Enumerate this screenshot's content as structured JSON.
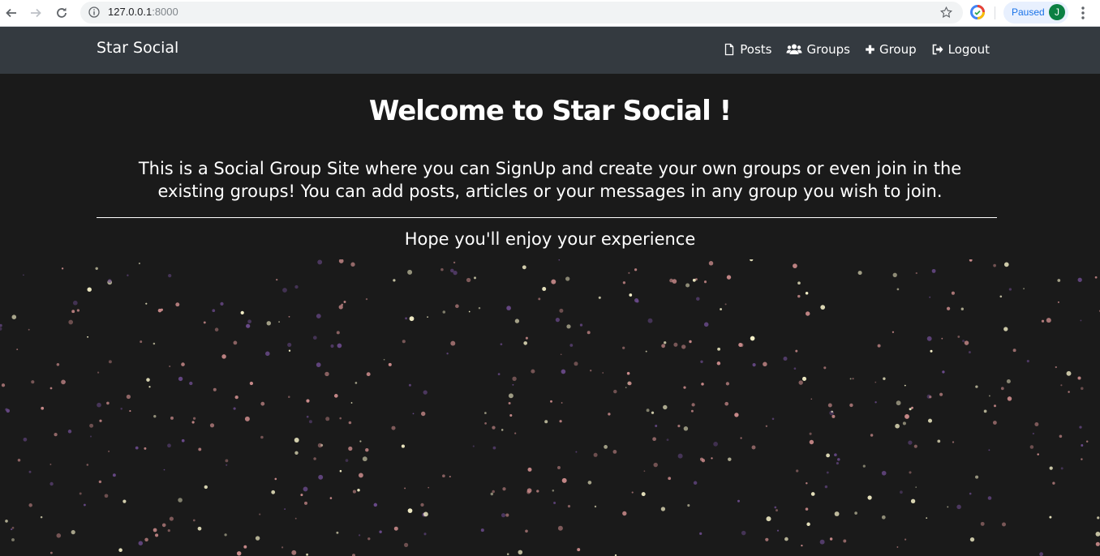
{
  "browser": {
    "url_host": "127.0.0.1",
    "url_port": ":8000",
    "profile_status": "Paused",
    "profile_initial": "J"
  },
  "navbar": {
    "brand": "Star Social",
    "links": [
      {
        "label": "Posts",
        "icon": "file-icon"
      },
      {
        "label": "Groups",
        "icon": "users-icon"
      },
      {
        "label": "Group",
        "icon": "plus-icon"
      },
      {
        "label": "Logout",
        "icon": "logout-icon"
      }
    ]
  },
  "main": {
    "heading": "Welcome to Star Social !",
    "intro": "This is a Social Group Site where you can SignUp and create your own groups or even join in the existing groups! You can add posts, articles or your messages in any group you wish to join.",
    "tagline": "Hope you'll enjoy your experience"
  },
  "colors": {
    "navbar_bg": "#343a40",
    "page_bg": "#1a1a1a",
    "particle_warm": "#f5f0c8",
    "particle_pink": "#c98a8a",
    "particle_purple": "#6a4a8a"
  }
}
